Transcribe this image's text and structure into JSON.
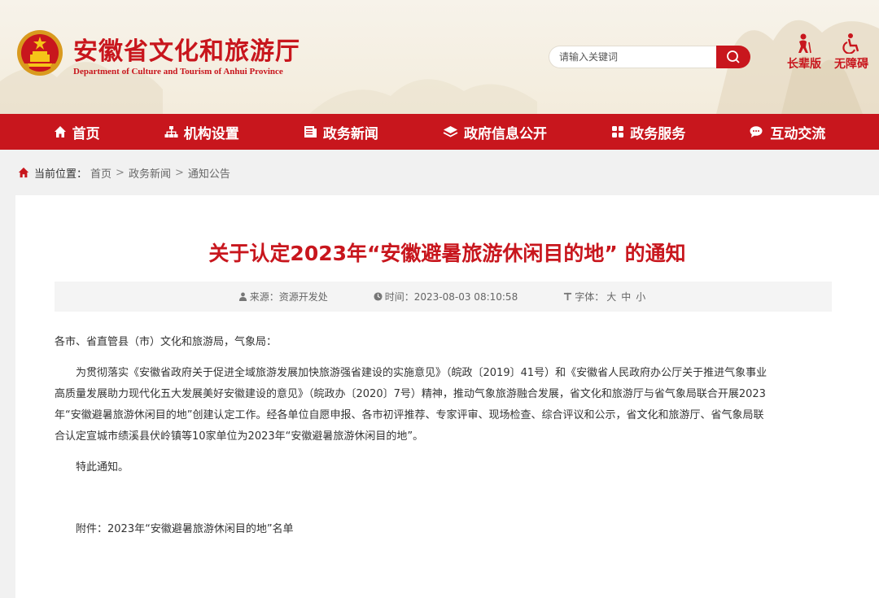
{
  "site": {
    "title": "安徽省文化和旅游厅",
    "subtitle": "Department of Culture and Tourism of Anhui Province"
  },
  "search": {
    "placeholder": "请输入关键词"
  },
  "tools": {
    "elder": "长辈版",
    "accessible": "无障碍"
  },
  "nav": [
    {
      "label": "首页",
      "icon": "home-icon"
    },
    {
      "label": "机构设置",
      "icon": "org-chart-icon"
    },
    {
      "label": "政务新闻",
      "icon": "newspaper-icon"
    },
    {
      "label": "政府信息公开",
      "icon": "layers-icon"
    },
    {
      "label": "政务服务",
      "icon": "grid-icon"
    },
    {
      "label": "互动交流",
      "icon": "chat-icon"
    }
  ],
  "breadcrumb": {
    "lead": "当前位置：",
    "items": [
      "首页",
      "政务新闻",
      "通知公告"
    ],
    "sep": ">"
  },
  "article": {
    "title": "关于认定2023年“安徽避暑旅游休闲目的地” 的通知",
    "meta": {
      "source": "来源：资源开发处",
      "time": "时间：2023-08-03 08:10:58",
      "font_label": "字体：",
      "sizes": [
        "大",
        "中",
        "小"
      ]
    },
    "salutation": "各市、省直管县（市）文化和旅游局，气象局：",
    "lines": [
      "为贯彻落实《安徽省政府关于促进全域旅游发展加快旅游强省建设的实施意见》（皖政〔2019〕41号）和《安徽省人民政府办公厅关于推进气象事业",
      "高质量发展助力现代化五大发展美好安徽建设的意见》（皖政办〔2020〕7号）精神，推动气象旅游融合发展，省文化和旅游厅与省气象局联合开展2023",
      "年“安徽避暑旅游休闲目的地”创建认定工作。经各单位自愿申报、各市初评推荐、专家评审、现场检查、综合评议和公示，省文化和旅游厅、省气象局联",
      "合认定宣城市绩溪县伏岭镇等10家单位为2023年“安徽避暑旅游休闲目的地”。"
    ],
    "closing": "特此通知。",
    "attachment": "附件：2023年“安徽避暑旅游休闲目的地”名单"
  },
  "colors": {
    "brand": "#c8161d",
    "page_bg": "#f1f1f1",
    "meta_bg": "#f4f4f4"
  }
}
